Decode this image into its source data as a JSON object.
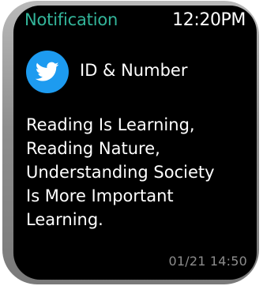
{
  "notification": {
    "app_title": "Notification",
    "clock": "12:20PM",
    "sender_icon": "twitter-icon",
    "sender_name": "ID & Number",
    "message": "Reading Is Learning,\nReading Nature,\nUnderstanding Society\nIs More Important\nLearning.",
    "timestamp": "01/21 14:50"
  },
  "colors": {
    "title_accent": "#33b59a",
    "twitter_blue": "#1d9bf0",
    "screen_background": "#000000",
    "timestamp_gray": "#8c8c8c"
  }
}
